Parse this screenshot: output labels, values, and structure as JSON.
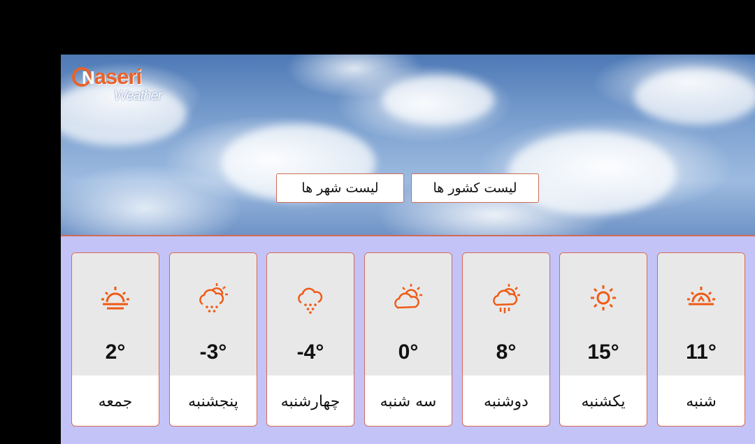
{
  "logo": {
    "brand": "aseri",
    "brand_initial": "N",
    "sub": "Weather"
  },
  "nav": {
    "countries_label": "لیست کشور ها",
    "cities_label": "لیست شهر ها"
  },
  "colors": {
    "accent": "#e8622a",
    "panel": "#c3c3f7",
    "card_border": "#d86a55"
  },
  "forecast": [
    {
      "day": "شنبه",
      "temp": "11°",
      "icon": "sunrise-icon"
    },
    {
      "day": "یکشنبه",
      "temp": "15°",
      "icon": "sun-icon"
    },
    {
      "day": "دوشنبه",
      "temp": "8°",
      "icon": "sun-cloud-rain-icon"
    },
    {
      "day": "سه شنبه",
      "temp": "0°",
      "icon": "partly-cloudy-icon"
    },
    {
      "day": "چهارشنبه",
      "temp": "-4°",
      "icon": "cloud-snow-icon"
    },
    {
      "day": "پنجشنبه",
      "temp": "-3°",
      "icon": "sun-cloud-snow-icon"
    },
    {
      "day": "جمعه",
      "temp": "2°",
      "icon": "sunset-icon"
    }
  ]
}
